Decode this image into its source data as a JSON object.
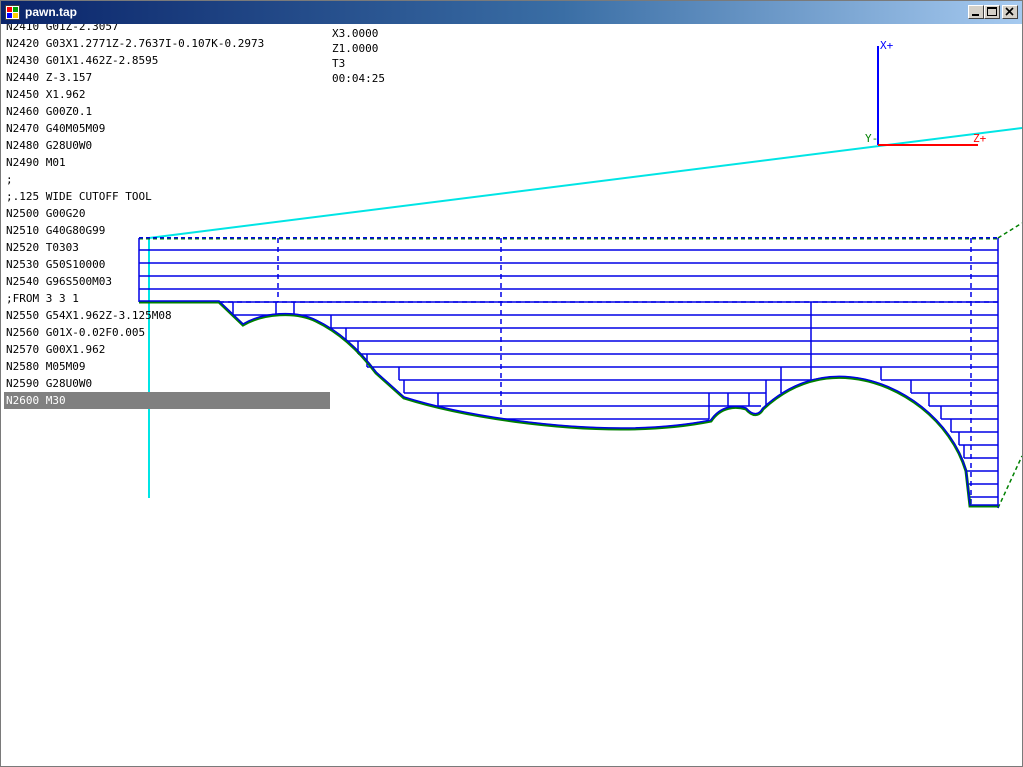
{
  "window": {
    "title": "pawn.tap",
    "colors": {
      "titlebar_start": "#0a246a",
      "titlebar_end": "#a6caf0"
    }
  },
  "caption_buttons": {
    "minimize": "minimize-icon",
    "maximize": "maximize-icon",
    "close": "close-icon"
  },
  "program": {
    "lines": [
      "N2410 G01Z-2.3057",
      "N2420 G03X1.2771Z-2.7637I-0.107K-0.2973",
      "N2430 G01X1.462Z-2.8595",
      "N2440 Z-3.157",
      "N2450 X1.962",
      "N2460 G00Z0.1",
      "N2470 G40M05M09",
      "N2480 G28U0W0",
      "N2490 M01",
      ";",
      ";.125 WIDE CUTOFF TOOL",
      "N2500 G00G20",
      "N2510 G40G80G99",
      "N2520 T0303",
      "N2530 G50S10000",
      "N2540 G96S500M03",
      ";FROM 3 3 1",
      "N2550 G54X1.962Z-3.125M08",
      "N2560 G01X-0.02F0.005",
      "N2570 G00X1.962",
      "N2580 M05M09",
      "N2590 G28U0W0",
      "N2600 M30"
    ],
    "current_line_index": 22
  },
  "readout": {
    "x": "X3.0000",
    "z": "Z1.0000",
    "tool": "T3",
    "time": "00:04:25"
  },
  "axes": {
    "x_label": "X+",
    "y_label": "Y-",
    "z_label": "Z+",
    "colors": {
      "x": "#0000ff",
      "y": "#008000",
      "z": "#ff0000"
    }
  },
  "colors": {
    "toolpath": "#0000e6",
    "finish_contour": "#008000",
    "rapid": "#00e5e5",
    "current_line_bg": "#808080"
  }
}
